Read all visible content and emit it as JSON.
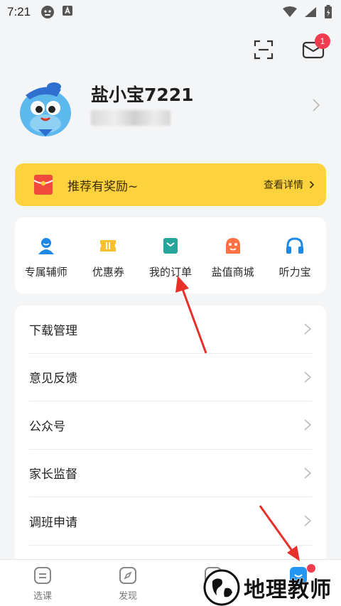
{
  "status_bar": {
    "time": "7:21"
  },
  "header": {
    "mail_badge": "1"
  },
  "profile": {
    "username": "盐小宝7221"
  },
  "banner": {
    "text": "推荐有奖励~",
    "link": "查看详情"
  },
  "quick_actions": [
    {
      "label": "专属辅师",
      "icon": "tutor-icon",
      "color": "#1e88e5"
    },
    {
      "label": "优惠券",
      "icon": "coupon-icon",
      "color": "#fbc02d"
    },
    {
      "label": "我的订单",
      "icon": "order-icon",
      "color": "#26a69a"
    },
    {
      "label": "盐值商城",
      "icon": "shop-icon",
      "color": "#ff7043"
    },
    {
      "label": "听力宝",
      "icon": "headphones-icon",
      "color": "#1e88e5"
    }
  ],
  "menu": [
    {
      "label": "下载管理"
    },
    {
      "label": "意见反馈"
    },
    {
      "label": "公众号"
    },
    {
      "label": "家长监督"
    },
    {
      "label": "调班申请"
    }
  ],
  "bottom_nav": [
    {
      "label": "选课",
      "icon": "course-icon"
    },
    {
      "label": "发现",
      "icon": "compass-icon"
    },
    {
      "label": "",
      "icon": "study-icon"
    },
    {
      "label": "",
      "icon": "me-icon"
    }
  ],
  "watermark": {
    "text": "地理教师"
  },
  "colors": {
    "banner_yellow": "#fdd23d",
    "badge_red": "#f23b4e",
    "arrow_red": "#e8302a",
    "active_blue": "#2196f3"
  }
}
